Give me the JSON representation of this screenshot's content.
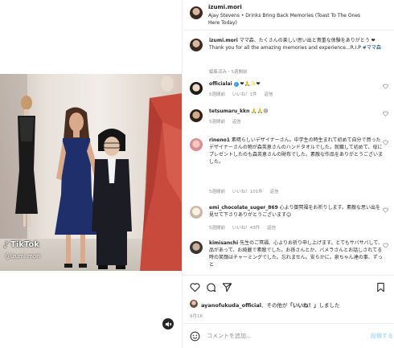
{
  "media": {
    "tiktok_logo_text": "TikTok",
    "tiktok_handle": "@izumi.mori",
    "mute_icon": "speaker-muted-icon"
  },
  "header": {
    "username": "izumi.mori",
    "audio_line": "Ajay Stevens • Drinks Bring Back Memories (Toast To The Ones Here Today)"
  },
  "caption": {
    "username": "izumi.mori",
    "text": "ママ森、たくさんの楽しい思い出と貴重な体験をありがとう",
    "heart": "❤",
    "text_en": "Thank you for all the amazing memories and experience...R.I.P",
    "hashtag": "#ママ森",
    "meta": "編集済み・5週間前"
  },
  "comments": [
    {
      "username": "officialai",
      "verified": true,
      "text": "❤🙏✨❤",
      "time": "5週間前",
      "likes": "いいね！1件",
      "reply": "返信"
    },
    {
      "username": "tetsumaru_kkn",
      "text": "🙏🙏😢",
      "time": "5週間前",
      "likes": "",
      "reply": "返信"
    },
    {
      "username": "rineno1",
      "text": "素晴らしいデザイナーさん。中学生の時生まれて初めて自分で買ったデザイナーさんの物が森英恵さんのハンドタオルでした。就職して初めて、母にプレゼントしたのも森英恵さんの財布でした。素敵な作品をありがとうございました。",
      "time": "5週間前",
      "likes": "いいね！101件",
      "reply": "返信"
    },
    {
      "username": "emi_chocolate_suger_869",
      "text": "心より御冥福をお祈りします。素敵な思い出を見せて下さりありがとうございます😊",
      "time": "5週間前",
      "likes": "いいね！43件",
      "reply": "返信"
    },
    {
      "username": "kimisanchi",
      "text": "先生のご冥福、心よりお祈り申し上げます。とてもサバサバして、品があって、お綺麗で素敵でした。お孫さんとか、バメラさんとお話しされてる時の笑顔はチャーミングでした。忘れません。安らかに。泉ちゃん達の事、ずっと",
      "time": "",
      "likes": "",
      "reply": ""
    }
  ],
  "actions": {
    "like_icon": "heart-outline-icon",
    "comment_icon": "comment-bubble-icon",
    "share_icon": "paper-plane-icon",
    "save_icon": "bookmark-icon"
  },
  "likes": {
    "username": "ayanofukuda_official",
    "middle": "、その他が",
    "highlight": "「いいね！」",
    "suffix": "しました"
  },
  "post_date": "9月16",
  "comment_box": {
    "placeholder": "コメントを追加...",
    "post_label": "投稿する",
    "emoji_icon": "smiley-icon"
  },
  "colors": {
    "link": "#00376b",
    "verified": "#3897f0",
    "post_button": "#b2dffc",
    "muted_text": "#8e8e8e"
  }
}
